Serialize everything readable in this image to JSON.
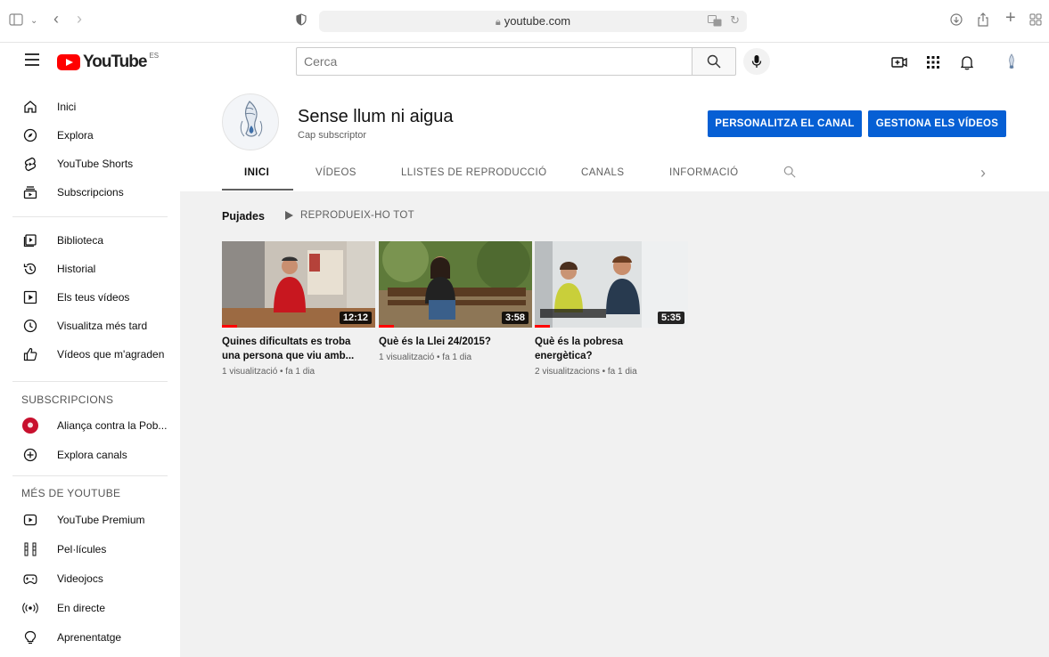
{
  "browser": {
    "url": "youtube.com"
  },
  "header": {
    "logo_text": "YouTube",
    "logo_region": "ES",
    "search_placeholder": "Cerca"
  },
  "sidebar": {
    "main": [
      {
        "label": "Inici",
        "icon": "home-icon"
      },
      {
        "label": "Explora",
        "icon": "compass-icon"
      },
      {
        "label": "YouTube Shorts",
        "icon": "shorts-icon"
      },
      {
        "label": "Subscripcions",
        "icon": "subscriptions-icon"
      }
    ],
    "library": [
      {
        "label": "Biblioteca",
        "icon": "library-icon"
      },
      {
        "label": "Historial",
        "icon": "history-icon"
      },
      {
        "label": "Els teus vídeos",
        "icon": "your-videos-icon"
      },
      {
        "label": "Visualitza més tard",
        "icon": "watch-later-icon"
      },
      {
        "label": "Vídeos que m'agraden",
        "icon": "thumbs-up-icon"
      }
    ],
    "subscriptions_heading": "SUBSCRIPCIONS",
    "subscriptions": [
      {
        "label": "Aliança contra la Pob...",
        "icon": "channel-avatar-icon"
      },
      {
        "label": "Explora canals",
        "icon": "add-circle-icon"
      }
    ],
    "more_heading": "MÉS DE YOUTUBE",
    "more": [
      {
        "label": "YouTube Premium",
        "icon": "premium-icon"
      },
      {
        "label": "Pel·lícules",
        "icon": "film-icon"
      },
      {
        "label": "Videojocs",
        "icon": "gaming-icon"
      },
      {
        "label": "En directe",
        "icon": "live-icon"
      },
      {
        "label": "Aprenentatge",
        "icon": "learning-icon"
      }
    ]
  },
  "channel": {
    "name": "Sense llum ni aigua",
    "subscribers": "Cap subscriptor",
    "customize_label": "PERSONALITZA EL CANAL",
    "manage_label": "GESTIONA ELS VÍDEOS",
    "tabs": [
      "INICI",
      "VÍDEOS",
      "LLISTES DE REPRODUCCIÓ",
      "CANALS",
      "INFORMACIÓ"
    ],
    "active_tab": "INICI"
  },
  "shelf": {
    "title": "Pujades",
    "play_all": "REPRODUEIX-HO TOT"
  },
  "videos": [
    {
      "title_line1": "Quines dificultats es troba",
      "title_line2": "una persona que viu amb...",
      "duration": "12:12",
      "meta": "1 visualització • fa 1 dia",
      "watched_fraction": 0.1
    },
    {
      "title_line1": "Què és la Llei 24/2015?",
      "title_line2": "",
      "duration": "3:58",
      "meta": "1 visualització • fa 1 dia",
      "watched_fraction": 0.1
    },
    {
      "title_line1": "Què és la pobresa",
      "title_line2": "energètica?",
      "duration": "5:35",
      "meta": "2 visualitzacions • fa 1 dia",
      "watched_fraction": 0.1
    }
  ],
  "colors": {
    "brand_red": "#ff0000",
    "button_blue": "#065fd4"
  }
}
